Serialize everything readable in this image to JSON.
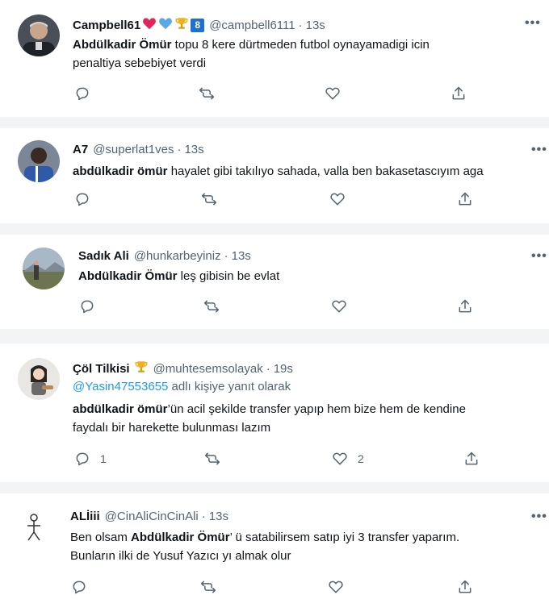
{
  "tweets": [
    {
      "name": "Campbell61",
      "handle": "@campbell6111",
      "time": "13s",
      "badges": [
        "red-heart-icon",
        "blue-heart-icon",
        "trophy-icon",
        "number-8-icon"
      ],
      "badge_num": "8",
      "mention": "Abdülkadir Ömür",
      "text_after": " topu 8 kere dürtmeden futbol oynayamadigi icin",
      "line2": "penaltiya sebebiyet verdi"
    },
    {
      "name": "A7",
      "handle": "@superlat1ves",
      "time": "13s",
      "mention": "abdülkadir ömür",
      "text_after": " hayalet gibi takılıyo sahada, valla ben bakasetascıyım aga"
    },
    {
      "name": "Sadık Ali",
      "handle": "@hunkarbeyiniz",
      "time": "13s",
      "mention": "Abdülkadir Ömür",
      "text_after": " leş gibisin be evlat"
    },
    {
      "name": "Çöl Tilkisi",
      "handle": "@muhtesemsolayak",
      "time": "19s",
      "reply_handle": "@Yasin47553655",
      "reply_text": " adlı kişiye yanıt olarak",
      "mention": "abdülkadir ömür",
      "text_after": "’ün acil şekilde transfer yapıp hem bize hem de kendine",
      "line2": "faydalı bir harekette bulunması lazım",
      "reply_count": "1",
      "like_count": "2"
    },
    {
      "name": "ALİiii",
      "handle": "@CinAliCinCinAli",
      "time": "13s",
      "text_before": "Ben olsam ",
      "mention": "Abdülkadir Ömür",
      "text_after": "’ ü satabilirsem satıp iyi 3 transfer yaparım.",
      "line2": "Bunların ilki de Yusuf Yazıcı yı almak olur"
    }
  ],
  "dot": "·",
  "more": "•••",
  "colors": {
    "link": "#1d9bf0",
    "muted": "#536471",
    "heart_red": "#e0245e",
    "heart_blue": "#5aa9e6",
    "badge_blue": "#1d6fd1",
    "trophy": "#f2b01e"
  }
}
